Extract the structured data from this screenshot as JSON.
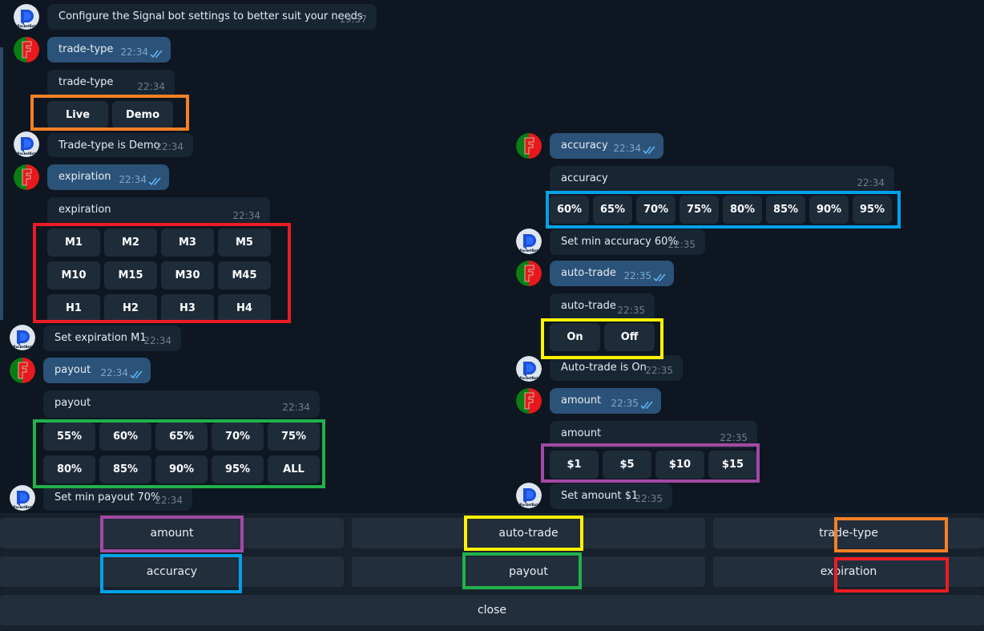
{
  "colors": {
    "orange": "#f58025",
    "red": "#ec1c24",
    "green": "#22b14c",
    "blue": "#00a2e8",
    "yellow": "#fff200",
    "purple": "#a349a4"
  },
  "left_messages": [
    {
      "sender": "bot",
      "text": "Configure the Signal bot settings to better suit your needs",
      "time": "19:57"
    },
    {
      "sender": "user",
      "text": "trade-type",
      "time": "22:34",
      "status": "read-double-check-icon"
    },
    {
      "sender": "bot",
      "text": "trade-type",
      "time": "22:34",
      "buttons": [
        [
          "Live",
          "Demo"
        ]
      ]
    },
    {
      "sender": "bot",
      "text": "Trade-type is Demo",
      "time": "22:34"
    },
    {
      "sender": "user",
      "text": "expiration",
      "time": "22:34",
      "status": "read-double-check-icon"
    },
    {
      "sender": "bot",
      "text": "expiration",
      "time": "22:34",
      "buttons": [
        [
          "M1",
          "M2",
          "M3",
          "M5"
        ],
        [
          "M10",
          "M15",
          "M30",
          "M45"
        ],
        [
          "H1",
          "H2",
          "H3",
          "H4"
        ]
      ]
    },
    {
      "sender": "bot",
      "text": "Set expiration M1",
      "time": "22:34"
    },
    {
      "sender": "user",
      "text": "payout",
      "time": "22:34",
      "status": "read-double-check-icon"
    },
    {
      "sender": "bot",
      "text": "payout",
      "time": "22:34",
      "buttons": [
        [
          "55%",
          "60%",
          "65%",
          "70%",
          "75%"
        ],
        [
          "80%",
          "85%",
          "90%",
          "95%",
          "ALL"
        ]
      ]
    },
    {
      "sender": "bot",
      "text": "Set min payout 70%",
      "time": "22:34"
    }
  ],
  "right_messages": [
    {
      "sender": "user",
      "text": "accuracy",
      "time": "22:34",
      "status": "read-double-check-icon"
    },
    {
      "sender": "bot",
      "text": "accuracy",
      "time": "22:34",
      "buttons": [
        [
          "60%",
          "65%",
          "70%",
          "75%",
          "80%",
          "85%",
          "90%",
          "95%"
        ]
      ]
    },
    {
      "sender": "bot",
      "text": "Set min accuracy 60%",
      "time": "22:35"
    },
    {
      "sender": "user",
      "text": "auto-trade",
      "time": "22:35",
      "status": "read-double-check-icon"
    },
    {
      "sender": "bot",
      "text": "auto-trade",
      "time": "22:35",
      "buttons": [
        [
          "On",
          "Off"
        ]
      ]
    },
    {
      "sender": "bot",
      "text": "Auto-trade is On",
      "time": "22:35"
    },
    {
      "sender": "user",
      "text": "amount",
      "time": "22:35",
      "status": "read-double-check-icon"
    },
    {
      "sender": "bot",
      "text": "amount",
      "time": "22:35",
      "buttons": [
        [
          "$1",
          "$5",
          "$10",
          "$15"
        ]
      ]
    },
    {
      "sender": "bot",
      "text": "Set amount $1",
      "time": "22:35"
    }
  ],
  "reply_keyboard": {
    "rows": [
      [
        "amount",
        "auto-trade",
        "trade-type"
      ],
      [
        "accuracy",
        "payout",
        "expiration"
      ],
      [
        "close"
      ]
    ]
  },
  "avatars": {
    "bot": "pocketbot-logo-icon",
    "user": "user-avatar-red-green-icon",
    "bot_label": "PocketBot"
  }
}
